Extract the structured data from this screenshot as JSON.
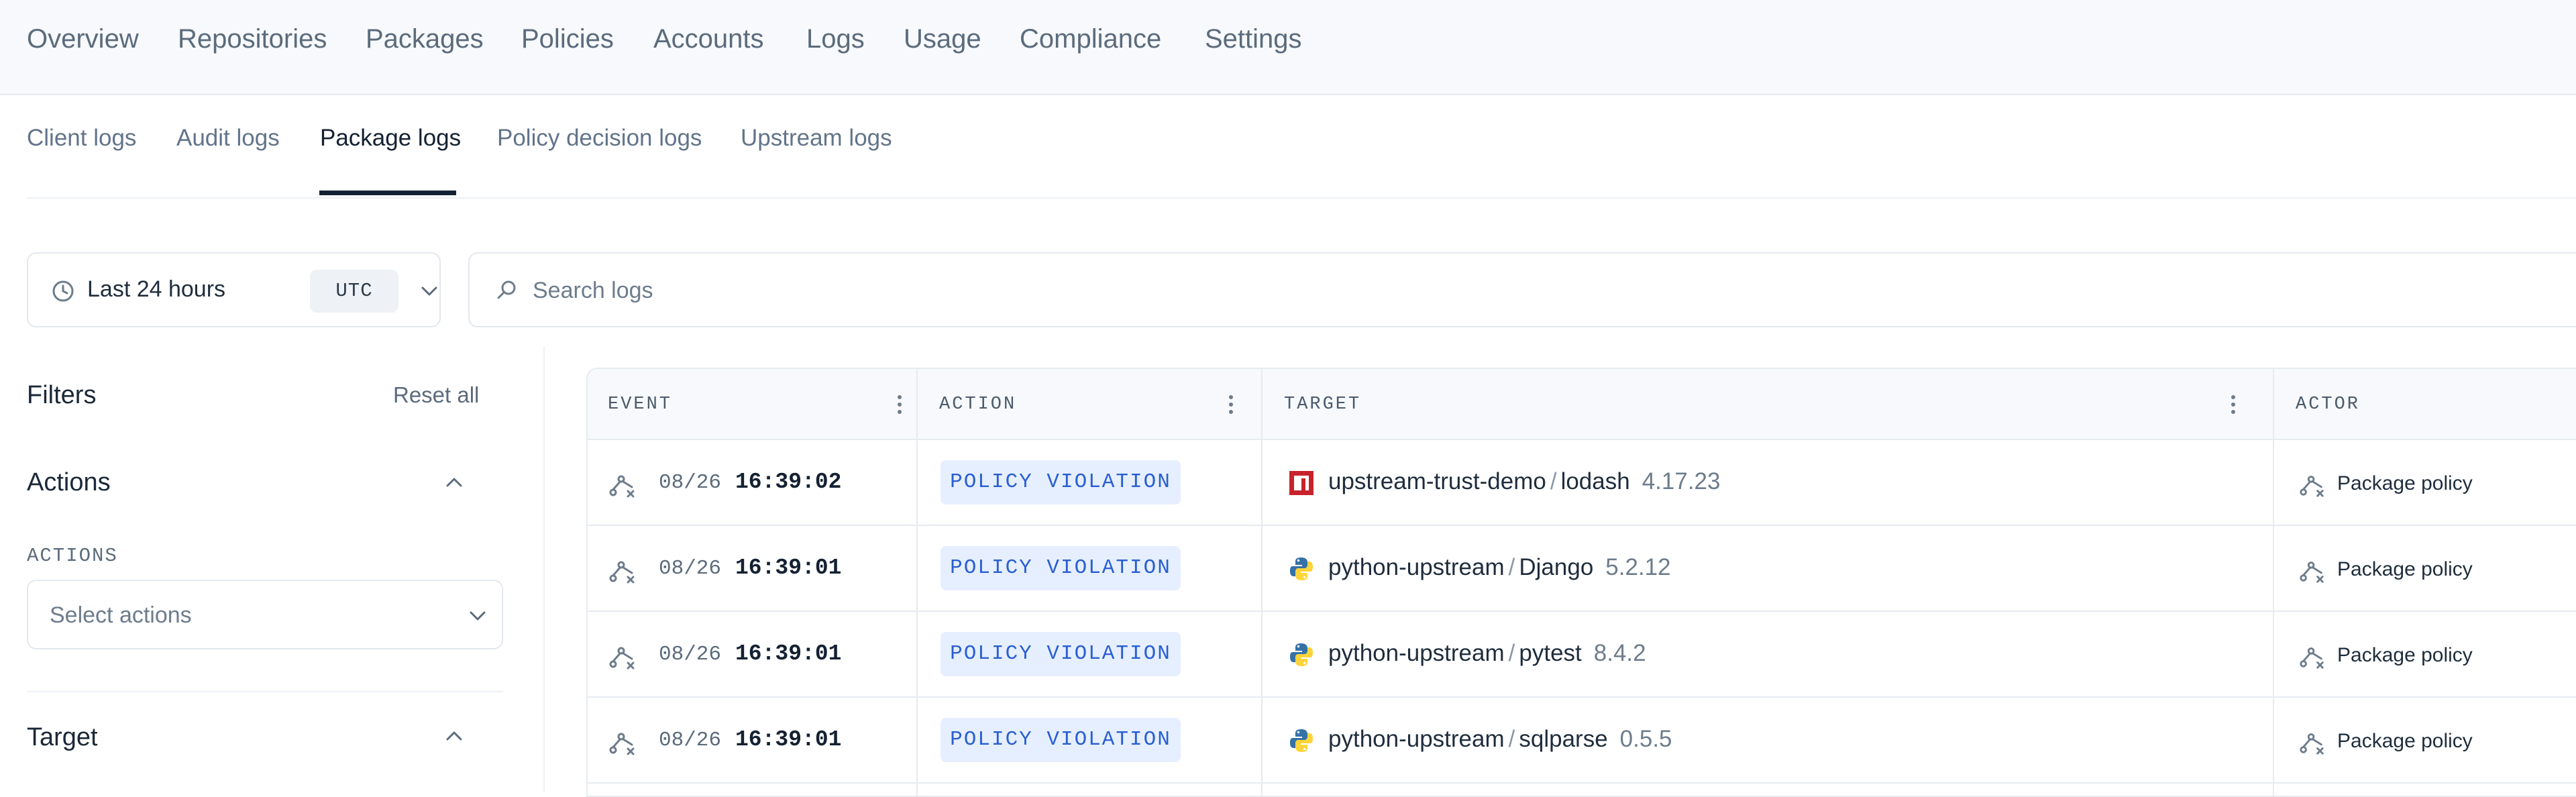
{
  "topnav": {
    "items": [
      "Overview",
      "Repositories",
      "Packages",
      "Policies",
      "Accounts",
      "Logs",
      "Usage",
      "Compliance",
      "Settings"
    ]
  },
  "subtabs": {
    "items": [
      "Client logs",
      "Audit logs",
      "Package logs",
      "Policy decision logs",
      "Upstream logs"
    ],
    "active": "Package logs"
  },
  "timepicker": {
    "label": "Last 24 hours",
    "timezone": "UTC"
  },
  "search": {
    "placeholder": "Search logs"
  },
  "filters": {
    "title": "Filters",
    "reset_label": "Reset all",
    "actions_section": "Actions",
    "actions_field_label": "ACTIONS",
    "actions_placeholder": "Select actions",
    "target_section": "Target"
  },
  "table": {
    "columns": [
      "EVENT",
      "ACTION",
      "TARGET",
      "ACTOR"
    ],
    "rows": [
      {
        "date": "08/26",
        "time": "16:39:02",
        "action": "POLICY VIOLATION",
        "repo": "upstream-trust-demo",
        "package": "lodash",
        "version": "4.17.23",
        "icon": "npm-icon",
        "actor": "Package policy"
      },
      {
        "date": "08/26",
        "time": "16:39:01",
        "action": "POLICY VIOLATION",
        "repo": "python-upstream",
        "package": "Django",
        "version": "5.2.12",
        "icon": "python-icon",
        "actor": "Package policy"
      },
      {
        "date": "08/26",
        "time": "16:39:01",
        "action": "POLICY VIOLATION",
        "repo": "python-upstream",
        "package": "pytest",
        "version": "8.4.2",
        "icon": "python-icon",
        "actor": "Package policy"
      },
      {
        "date": "08/26",
        "time": "16:39:01",
        "action": "POLICY VIOLATION",
        "repo": "python-upstream",
        "package": "sqlparse",
        "version": "0.5.5",
        "icon": "python-icon",
        "actor": "Package policy"
      }
    ]
  },
  "colors": {
    "nav_bg": "#f7f9fc",
    "active_tab": "#142132",
    "badge_bg": "#e6efff",
    "badge_text": "#2a5fd1",
    "npm_red": "#c8232c",
    "python_blue": "#3572a5",
    "python_yellow": "#ffd43b"
  }
}
